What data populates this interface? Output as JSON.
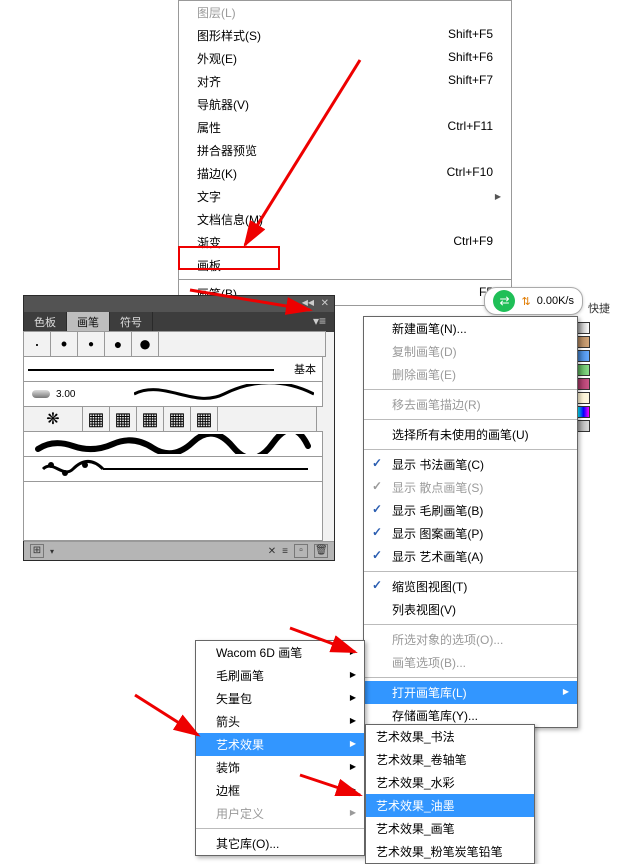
{
  "top_menu": {
    "items": [
      {
        "label": "图层(L)",
        "shortcut": ""
      },
      {
        "label": "图形样式(S)",
        "shortcut": "Shift+F5"
      },
      {
        "label": "外观(E)",
        "shortcut": "Shift+F6"
      },
      {
        "label": "对齐",
        "shortcut": "Shift+F7"
      },
      {
        "label": "导航器(V)",
        "shortcut": ""
      },
      {
        "label": "属性",
        "shortcut": "Ctrl+F11"
      },
      {
        "label": "拼合器预览",
        "shortcut": ""
      },
      {
        "label": "描边(K)",
        "shortcut": "Ctrl+F10"
      },
      {
        "label": "文字",
        "shortcut": "",
        "sub": true
      },
      {
        "label": "文档信息(M)",
        "shortcut": ""
      },
      {
        "label": "渐变",
        "shortcut": "Ctrl+F9"
      },
      {
        "label": "画板",
        "shortcut": ""
      },
      {
        "label": "画笔(B)",
        "shortcut": "F5"
      }
    ]
  },
  "panel": {
    "tabs": {
      "swatch": "色板",
      "brush": "画笔",
      "symbol": "符号"
    },
    "basic_label": "基本",
    "size_value": "3.00",
    "footer": {}
  },
  "ctx": {
    "new": "新建画笔(N)...",
    "dup": "复制画笔(D)",
    "del": "删除画笔(E)",
    "remove": "移去画笔描边(R)",
    "select_unused": "选择所有未使用的画笔(U)",
    "show_calli": "显示 书法画笔(C)",
    "show_scatter": "显示 散点画笔(S)",
    "show_brush": "显示 毛刷画笔(B)",
    "show_pattern": "显示 图案画笔(P)",
    "show_art": "显示 艺术画笔(A)",
    "thumb": "缩览图视图(T)",
    "list": "列表视图(V)",
    "sel_opt": "所选对象的选项(O)...",
    "brush_opt": "画笔选项(B)...",
    "open_lib": "打开画笔库(L)",
    "save_lib": "存储画笔库(Y)..."
  },
  "lib": {
    "wacom": "Wacom 6D 画笔",
    "maosha": "毛刷画笔",
    "vector": "矢量包",
    "arrow": "箭头",
    "art": "艺术效果",
    "deco": "装饰",
    "border": "边框",
    "user": "用户定义",
    "other": "其它库(O)..."
  },
  "art": {
    "calli": "艺术效果_书法",
    "scroll": "艺术效果_卷轴笔",
    "water": "艺术效果_水彩",
    "ink": "艺术效果_油墨",
    "brush": "艺术效果_画笔",
    "chalk": "艺术效果_粉笔炭笔铅笔"
  },
  "net_badge": {
    "speed": "0.00K/s",
    "ext": "快捷"
  },
  "side_colors": [
    "#000000",
    "#5a3a1e",
    "#0055aa",
    "#00aa55",
    "#c2185b",
    "#f0e0b0",
    "#999999",
    "#ffffff"
  ]
}
